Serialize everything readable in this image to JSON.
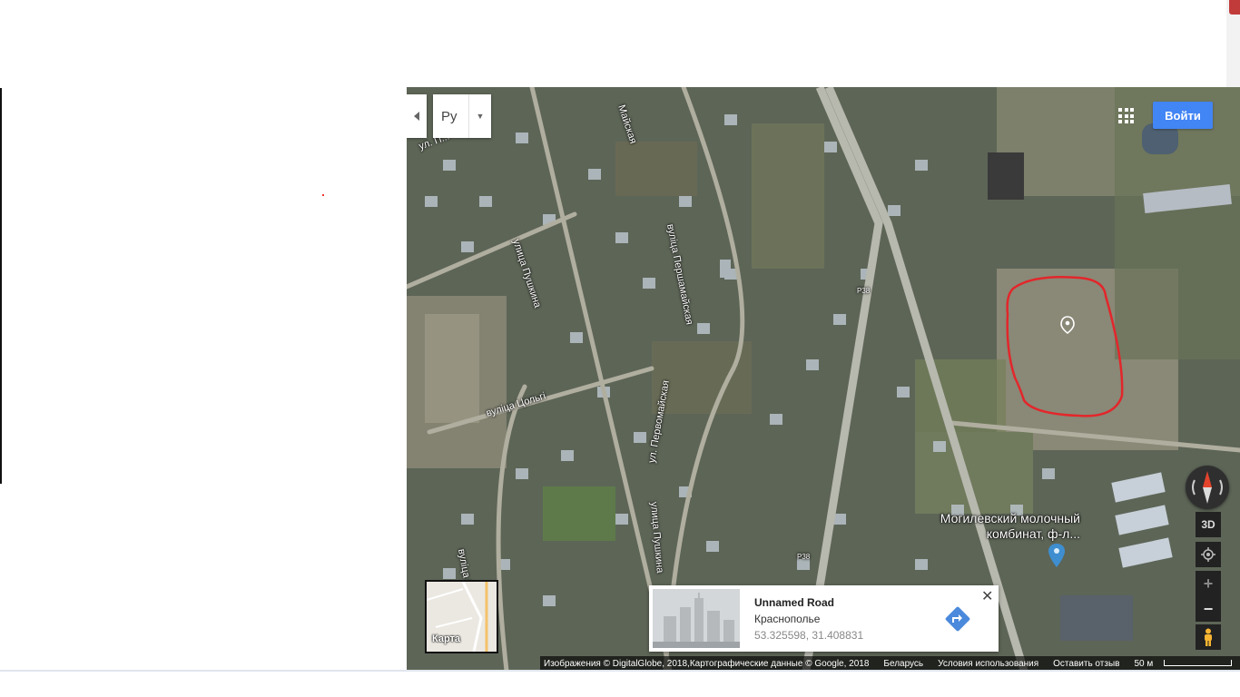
{
  "language": {
    "toggle_icon": "chevron-left-icon",
    "selected": "Ру",
    "dropdown_icon": "caret-down-icon"
  },
  "header": {
    "apps_icon": "apps-grid-icon",
    "signin_label": "Войти",
    "signin_color": "#4285f4"
  },
  "map": {
    "view": "satellite",
    "road_labels": [
      "ул. П...",
      "Майская",
      "улица Пушкина",
      "вуліца Першамайская",
      "вуліца Цольгі",
      "ул. Первомайская",
      "улица Пушкина",
      "вуліца Пушкина",
      "Р38",
      "Р38"
    ],
    "poi_label": "Могилевский молочный комбинат, ф-л...",
    "highlight_color": "#e3262b",
    "selected_marker": "location-marker-icon"
  },
  "controls": {
    "compass": "compass-icon",
    "tilt_label": "3D",
    "my_location": "my-location-icon",
    "zoom_in": "+",
    "zoom_out": "−",
    "street_view": "pegman-icon"
  },
  "minimap": {
    "label": "Карта"
  },
  "info_card": {
    "title": "Unnamed Road",
    "locality": "Краснополье",
    "coordinates": "53.325598, 31.408831",
    "directions_icon": "directions-icon",
    "close_icon": "close-icon"
  },
  "footer": {
    "attribution": "Изображения © DigitalGlobe, 2018,Картографические данные © Google, 2018",
    "country": "Беларусь",
    "terms": "Условия использования",
    "feedback": "Оставить отзыв",
    "scale": "50 м"
  }
}
